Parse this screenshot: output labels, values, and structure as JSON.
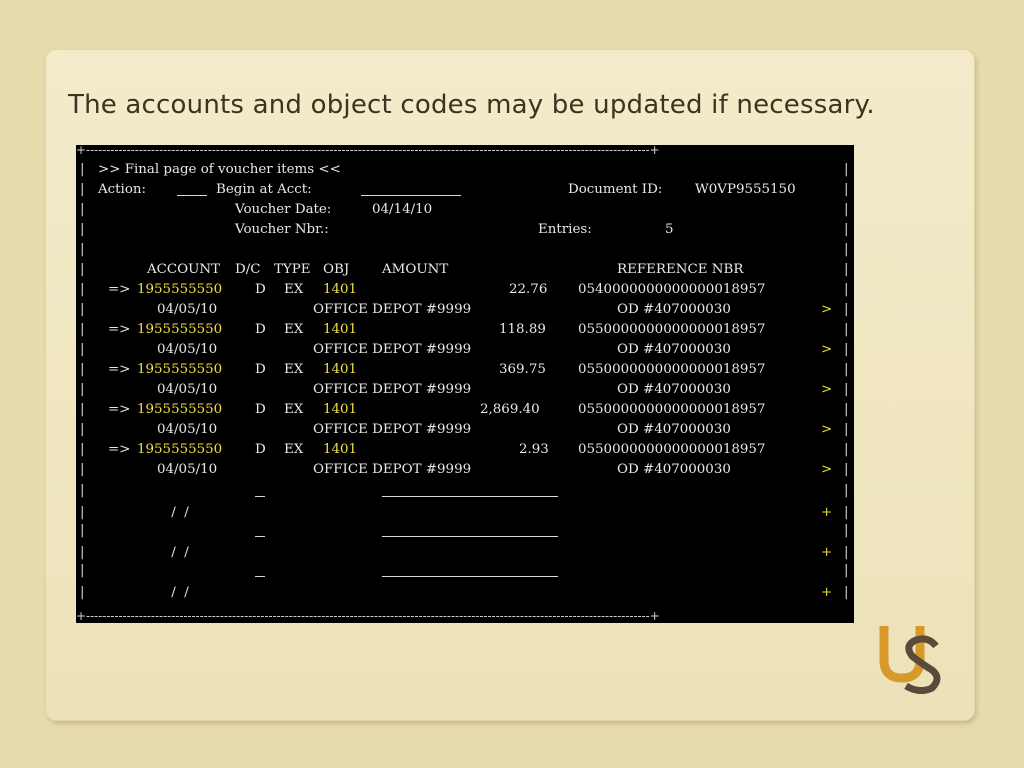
{
  "slide": {
    "title": "The accounts and object codes may be updated if necessary."
  },
  "screen": {
    "header_line": ">> Final page of voucher items <<",
    "action_label": "Action:",
    "begin_label": "Begin at Acct:",
    "document_label": "Document ID:",
    "document_id": "W0VP9555150",
    "voucher_date_label": "Voucher Date:",
    "voucher_date": "04/14/10",
    "voucher_nbr_label": "Voucher Nbr.:",
    "entries_label": "Entries:",
    "entries_count": "5",
    "columns": {
      "account": "ACCOUNT",
      "dc": "D/C",
      "type": "TYPE",
      "obj": "OBJ",
      "amount": "AMOUNT",
      "reference": "REFERENCE NBR"
    },
    "items": [
      {
        "arrow": "=>",
        "account": "1955555550",
        "dc": "D",
        "type": "EX",
        "obj": "1401",
        "amount": "22.76",
        "reference": "0540000000000000018957",
        "date": "04/05/10",
        "vendor": "OFFICE DEPOT #9999",
        "ref2": "OD #407000030",
        "more": ">"
      },
      {
        "arrow": "=>",
        "account": "1955555550",
        "dc": "D",
        "type": "EX",
        "obj": "1401",
        "amount": "118.89",
        "reference": "0550000000000000018957",
        "date": "04/05/10",
        "vendor": "OFFICE DEPOT #9999",
        "ref2": "OD #407000030",
        "more": ">"
      },
      {
        "arrow": "=>",
        "account": "1955555550",
        "dc": "D",
        "type": "EX",
        "obj": "1401",
        "amount": "369.75",
        "reference": "0550000000000000018957",
        "date": "04/05/10",
        "vendor": "OFFICE DEPOT #9999",
        "ref2": "OD #407000030",
        "more": ">"
      },
      {
        "arrow": "=>",
        "account": "1955555550",
        "dc": "D",
        "type": "EX",
        "obj": "1401",
        "amount": "2,869.40",
        "reference": "0550000000000000018957",
        "date": "04/05/10",
        "vendor": "OFFICE DEPOT #9999",
        "ref2": "OD #407000030",
        "more": ">"
      },
      {
        "arrow": "=>",
        "account": "1955555550",
        "dc": "D",
        "type": "EX",
        "obj": "1401",
        "amount": "2.93",
        "reference": "0550000000000000018957",
        "date": "04/05/10",
        "vendor": "OFFICE DEPOT #9999",
        "ref2": "OD #407000030",
        "more": ">"
      }
    ],
    "blank_rows": [
      {
        "date": " /  /",
        "more": "+"
      },
      {
        "date": " /  /",
        "more": "+"
      },
      {
        "date": " /  /",
        "more": "+"
      }
    ]
  },
  "logo": {
    "text": "US",
    "gold": "#d79a2a",
    "dark": "#5a4a3a"
  }
}
